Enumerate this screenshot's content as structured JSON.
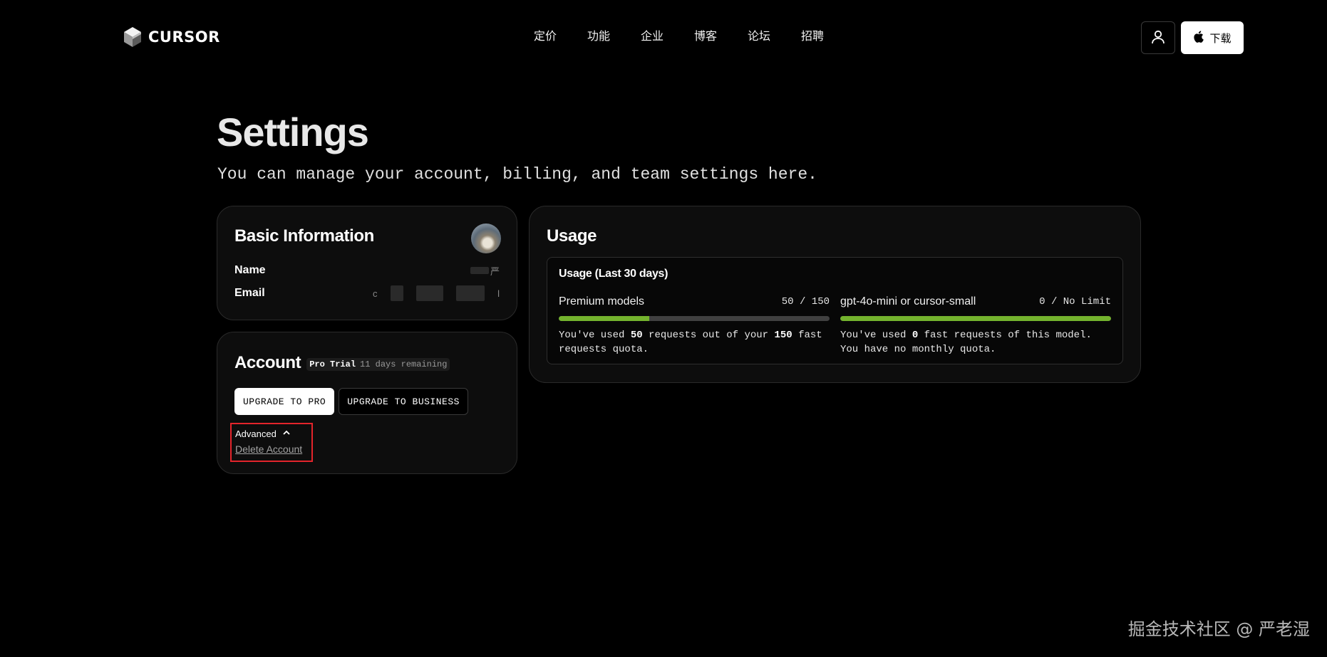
{
  "nav": {
    "logo_text": "CURSOR",
    "links": [
      "定价",
      "功能",
      "企业",
      "博客",
      "论坛",
      "招聘"
    ],
    "download_label": "下载"
  },
  "header": {
    "title": "Settings",
    "subtitle": "You can manage your account, billing, and team settings here."
  },
  "basic_info": {
    "heading": "Basic Information",
    "name_label": "Name",
    "name_value": "严",
    "email_label": "Email",
    "email_value_start": "c",
    "email_value_end": "l"
  },
  "account": {
    "heading": "Account",
    "plan_name": "Pro Trial",
    "plan_remaining": "11 days remaining",
    "upgrade_pro_label": "UPGRADE TO PRO",
    "upgrade_business_label": "UPGRADE TO BUSINESS",
    "advanced_label": "Advanced",
    "delete_label": "Delete Account"
  },
  "usage": {
    "heading": "Usage",
    "period_label": "Usage (Last 30 days)",
    "premium": {
      "name": "Premium models",
      "count": "50 / 150",
      "used": 50,
      "limit": 150,
      "fill_fraction": 0.333,
      "desc_prefix": "You've used ",
      "desc_used": "50",
      "desc_middle": " requests out of your ",
      "desc_limit": "150",
      "desc_suffix": " fast requests quota."
    },
    "small": {
      "name": "gpt-4o-mini or cursor-small",
      "count": "0 / No Limit",
      "fill_fraction": 1.0,
      "desc_prefix": "You've used ",
      "desc_used": "0",
      "desc_suffix": " fast requests of this model. You have no monthly quota."
    }
  },
  "watermark": "掘金技术社区 @ 严老湿",
  "colors": {
    "background": "#000000",
    "card": "#0d0d0d",
    "progress_green": "#74b32e",
    "highlight_red": "#e3242b"
  }
}
